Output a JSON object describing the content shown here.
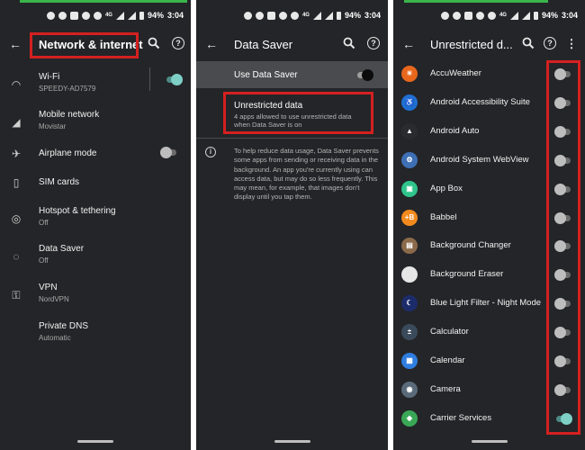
{
  "status": {
    "battery": "94%",
    "time": "3:04",
    "network": "4G"
  },
  "panel1": {
    "title": "Network & internet",
    "items": [
      {
        "icon": "wifi-icon",
        "title": "Wi-Fi",
        "subtitle": "SPEEDY-AD7579",
        "toggle": "on"
      },
      {
        "icon": "cellular-signal-icon",
        "title": "Mobile network",
        "subtitle": "Movistar"
      },
      {
        "icon": "airplane-icon",
        "title": "Airplane mode",
        "subtitle": "",
        "toggle": "off"
      },
      {
        "icon": "sim-card-icon",
        "title": "SIM cards",
        "subtitle": ""
      },
      {
        "icon": "hotspot-icon",
        "title": "Hotspot & tethering",
        "subtitle": "Off"
      },
      {
        "icon": "data-saver-icon",
        "title": "Data Saver",
        "subtitle": "Off"
      },
      {
        "icon": "vpn-key-icon",
        "title": "VPN",
        "subtitle": "NordVPN"
      },
      {
        "icon": "",
        "title": "Private DNS",
        "subtitle": "Automatic"
      }
    ]
  },
  "panel2": {
    "title": "Data Saver",
    "use_data_saver": "Use Data Saver",
    "unrestricted_title": "Unrestricted data",
    "unrestricted_sub": "4 apps allowed to use unrestricted data when Data Saver is on",
    "info": "To help reduce data usage, Data Saver prevents some apps from sending or receiving data in the background. An app you're currently using can access data, but may do so less frequently. This may mean, for example, that images don't display until you tap them."
  },
  "panel3": {
    "title": "Unrestricted d...",
    "apps": [
      {
        "name": "AccuWeather",
        "icon_color": "#e8671d",
        "glyph": "☀",
        "enabled": false
      },
      {
        "name": "Android Accessibility Suite",
        "icon_color": "#1f6fd1",
        "glyph": "♿",
        "enabled": false
      },
      {
        "name": "Android Auto",
        "icon_color": "#2a2b2e",
        "glyph": "▲",
        "enabled": false
      },
      {
        "name": "Android System WebView",
        "icon_color": "#3e6fb5",
        "glyph": "⚙",
        "enabled": false
      },
      {
        "name": "App Box",
        "icon_color": "#2ec48b",
        "glyph": "▣",
        "enabled": false
      },
      {
        "name": "Babbel",
        "icon_color": "#f28a1e",
        "glyph": "+B",
        "enabled": false
      },
      {
        "name": "Background Changer",
        "icon_color": "#8a6a4a",
        "glyph": "▤",
        "enabled": false
      },
      {
        "name": "Background Eraser",
        "icon_color": "#e6e6e6",
        "glyph": "",
        "enabled": false
      },
      {
        "name": "Blue Light Filter - Night Mode",
        "icon_color": "#1c2c6b",
        "glyph": "☾",
        "enabled": false
      },
      {
        "name": "Calculator",
        "icon_color": "#3a4a5a",
        "glyph": "±",
        "enabled": false
      },
      {
        "name": "Calendar",
        "icon_color": "#2f7de0",
        "glyph": "▦",
        "enabled": false
      },
      {
        "name": "Camera",
        "icon_color": "#5a6a7a",
        "glyph": "◉",
        "enabled": false
      },
      {
        "name": "Carrier Services",
        "icon_color": "#3aa757",
        "glyph": "◆",
        "enabled": true
      }
    ]
  }
}
